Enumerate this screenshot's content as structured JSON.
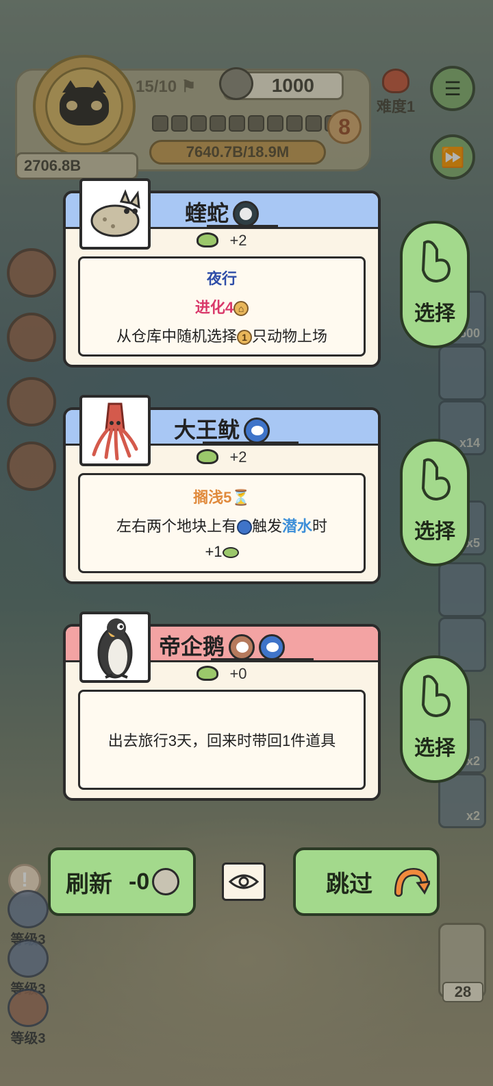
{
  "hud": {
    "flag_counter": "15/10",
    "coins": "1000",
    "money": "2706.8B",
    "xp_text": "7640.7B/18.9M",
    "level_badge": "8",
    "difficulty": "难度1"
  },
  "cards": [
    {
      "name": "蝰蛇",
      "score": "+2",
      "header_color": "#a8c7f4",
      "lines": {
        "trait": "夜行",
        "evolve": "进化4",
        "effect_a": "从仓库中随机选择",
        "effect_num": "1",
        "effect_b": "只动物上场"
      },
      "select_label": "选择"
    },
    {
      "name": "大王鱿",
      "score": "+2",
      "header_color": "#a8c7f4",
      "lines": {
        "trait": "搁浅5⏳",
        "effect_a": "左右两个地块上有",
        "effect_b": "触发",
        "dive": "潜水",
        "effect_c": "时",
        "gain": "+1"
      },
      "select_label": "选择"
    },
    {
      "name": "帝企鹅",
      "score": "+0",
      "header_color": "#f3a3a3",
      "lines": {
        "effect": "出去旅行3天，回来时带回1件道具"
      },
      "select_label": "选择"
    }
  ],
  "controls": {
    "refresh_label": "刷新",
    "refresh_cost": "-0",
    "skip_label": "跳过"
  },
  "side": {
    "right_slots": [
      "500",
      "",
      "x14",
      "x5",
      "",
      "",
      "x2",
      "x2"
    ],
    "left_levels": [
      "等级3",
      "等级3",
      "等级3"
    ],
    "bottom_right_number": "28"
  },
  "colors": {
    "button_green": "#a3d98c",
    "header_blue": "#a8c7f4",
    "header_pink": "#f3a3a3",
    "card_bg": "#fbf4e6"
  }
}
